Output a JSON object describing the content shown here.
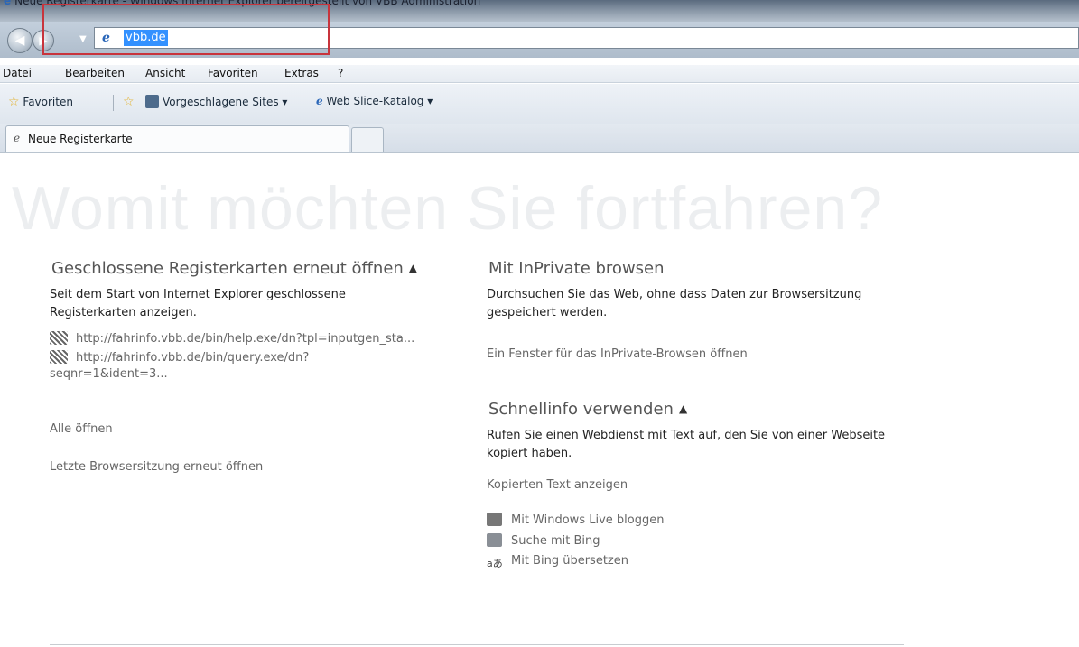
{
  "window": {
    "title": "Neue Registerkarte - Windows Internet Explorer bereitgestellt von VBB Administration"
  },
  "address_bar": {
    "value": "vbb.de"
  },
  "menu": {
    "items": [
      "Datei",
      "Bearbeiten",
      "Ansicht",
      "Favoriten",
      "Extras",
      "?"
    ]
  },
  "favorites_bar": {
    "favorites_label": "Favoriten",
    "suggested_sites": "Vorgeschlagene Sites",
    "web_slice": "Web Slice-Katalog"
  },
  "tabs": {
    "active_label": "Neue Registerkarte"
  },
  "page": {
    "headline": "Womit möchten Sie fortfahren?",
    "closed_tabs": {
      "title": "Geschlossene Registerkarten erneut öffnen",
      "description": "Seit dem Start von Internet Explorer geschlossene Registerkarten anzeigen.",
      "urls": [
        "http://fahrinfo.vbb.de/bin/help.exe/dn?tpl=inputgen_sta...",
        "http://fahrinfo.vbb.de/bin/query.exe/dn?",
        "seqnr=1&ident=3..."
      ],
      "open_all": "Alle öffnen",
      "reopen_session": "Letzte Browsersitzung erneut öffnen"
    },
    "inprivate": {
      "title": "Mit InPrivate browsen",
      "description": "Durchsuchen Sie das Web, ohne dass Daten zur Browsersitzung gespeichert werden.",
      "open_window": "Ein Fenster für das InPrivate-Browsen öffnen"
    },
    "accelerators": {
      "title": "Schnellinfo verwenden",
      "description": "Rufen Sie einen Webdienst mit Text auf, den Sie von einer Webseite kopiert haben.",
      "show_copied": "Kopierten Text anzeigen",
      "items": [
        "Mit Windows Live bloggen",
        "Suche mit Bing",
        "Mit Bing übersetzen"
      ]
    }
  }
}
